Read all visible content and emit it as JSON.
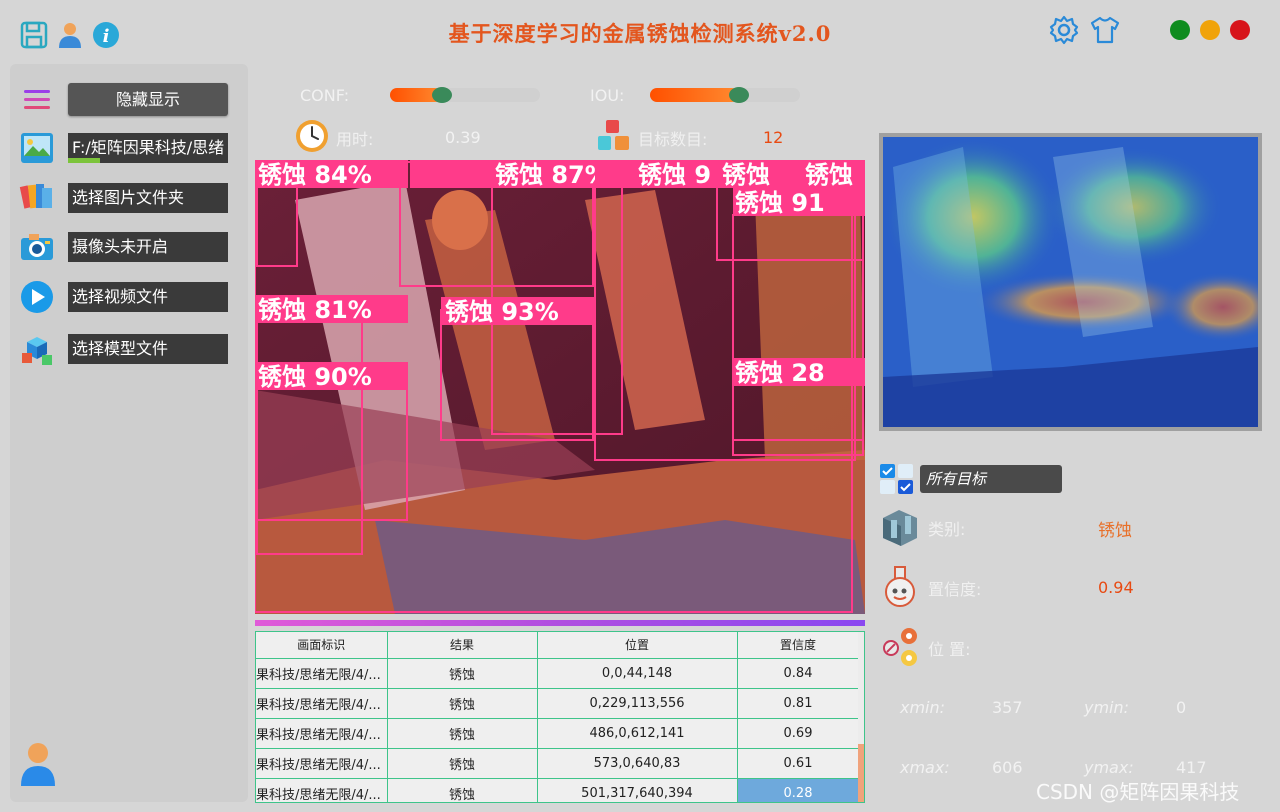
{
  "app": {
    "title": "基于深度学习的金属锈蚀检测系统v2.0"
  },
  "colors": {
    "accent_orange": "#e3561e",
    "window_green": "#0e8c1e",
    "window_yellow": "#f0a30a",
    "window_red": "#d7141a"
  },
  "sidebar": {
    "toggle_label": "隐藏显示",
    "image_path": "F:/矩阵因果科技/思绪",
    "image_folder_label": "选择图片文件夹",
    "camera_label": "摄像头未开启",
    "video_label": "选择视频文件",
    "model_label": "选择模型文件"
  },
  "controls": {
    "conf_label": "CONF:",
    "conf_value": 0.29,
    "iou_label": "IOU:",
    "iou_value": 0.54
  },
  "stats": {
    "time_label": "用时:",
    "time_value": "0.39",
    "count_label": "目标数目:",
    "count_value": "12"
  },
  "detections": [
    {
      "label": "锈蚀 84%"
    },
    {
      "label": "锈蚀 87%"
    },
    {
      "label": "锈蚀 9"
    },
    {
      "label": "锈蚀"
    },
    {
      "label": "锈蚀"
    },
    {
      "label": "锈蚀 91"
    },
    {
      "label": "锈蚀 81%"
    },
    {
      "label": "锈蚀 93%"
    },
    {
      "label": "锈蚀 90%"
    },
    {
      "label": "锈蚀 28"
    }
  ],
  "table": {
    "headers": [
      "画面标识",
      "结果",
      "位置",
      "置信度"
    ],
    "rows": [
      [
        "果科技/思绪无限/4/...",
        "锈蚀",
        "0,0,44,148",
        "0.84"
      ],
      [
        "果科技/思绪无限/4/...",
        "锈蚀",
        "0,229,113,556",
        "0.81"
      ],
      [
        "果科技/思绪无限/4/...",
        "锈蚀",
        "486,0,612,141",
        "0.69"
      ],
      [
        "果科技/思绪无限/4/...",
        "锈蚀",
        "573,0,640,83",
        "0.61"
      ],
      [
        "果科技/思绪无限/4/...",
        "锈蚀",
        "501,317,640,394",
        "0.28"
      ]
    ]
  },
  "details": {
    "target_select": "所有目标",
    "class_label": "类别:",
    "class_value": "锈蚀",
    "conf_label": "置信度:",
    "conf_value": "0.94",
    "position_label": "位 置:",
    "xmin_label": "xmin:",
    "xmin_value": "357",
    "ymin_label": "ymin:",
    "ymin_value": "0",
    "xmax_label": "xmax:",
    "xmax_value": "606",
    "ymax_label": "ymax:",
    "ymax_value": "417"
  },
  "watermark": "CSDN @矩阵因果科技"
}
